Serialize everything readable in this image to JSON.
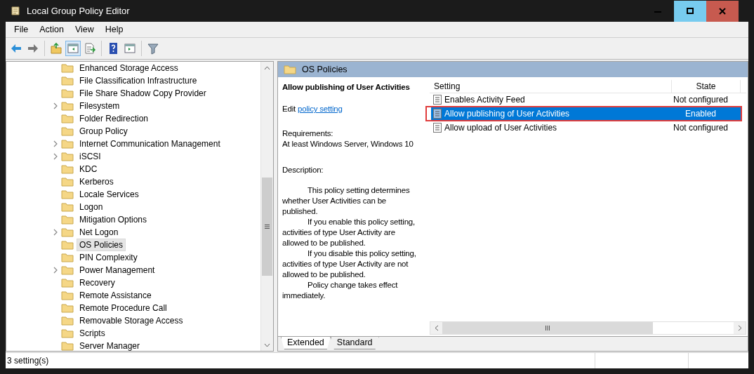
{
  "window": {
    "title": "Local Group Policy Editor"
  },
  "menu": [
    "File",
    "Action",
    "View",
    "Help"
  ],
  "toolbar": [
    {
      "kind": "back",
      "selected": false
    },
    {
      "kind": "forward",
      "selected": false
    },
    {
      "kind": "separator"
    },
    {
      "kind": "up",
      "selected": false
    },
    {
      "kind": "console-tree",
      "selected": true
    },
    {
      "kind": "export",
      "selected": false
    },
    {
      "kind": "separator"
    },
    {
      "kind": "help",
      "selected": false
    },
    {
      "kind": "show-pane",
      "selected": false
    },
    {
      "kind": "separator"
    },
    {
      "kind": "filter",
      "selected": false
    }
  ],
  "tree": {
    "items": [
      {
        "label": "Enhanced Storage Access",
        "kind": "leaf",
        "selected": false
      },
      {
        "label": "File Classification Infrastructure",
        "kind": "leaf",
        "selected": false
      },
      {
        "label": "File Share Shadow Copy Provider",
        "kind": "leaf",
        "selected": false
      },
      {
        "label": "Filesystem",
        "kind": "branch",
        "selected": false
      },
      {
        "label": "Folder Redirection",
        "kind": "leaf",
        "selected": false
      },
      {
        "label": "Group Policy",
        "kind": "leaf",
        "selected": false
      },
      {
        "label": "Internet Communication Management",
        "kind": "branch",
        "selected": false
      },
      {
        "label": "iSCSI",
        "kind": "branch",
        "selected": false
      },
      {
        "label": "KDC",
        "kind": "leaf",
        "selected": false
      },
      {
        "label": "Kerberos",
        "kind": "leaf",
        "selected": false
      },
      {
        "label": "Locale Services",
        "kind": "leaf",
        "selected": false
      },
      {
        "label": "Logon",
        "kind": "leaf",
        "selected": false
      },
      {
        "label": "Mitigation Options",
        "kind": "leaf",
        "selected": false
      },
      {
        "label": "Net Logon",
        "kind": "branch",
        "selected": false
      },
      {
        "label": "OS Policies",
        "kind": "leaf",
        "selected": true
      },
      {
        "label": "PIN Complexity",
        "kind": "leaf",
        "selected": false
      },
      {
        "label": "Power Management",
        "kind": "branch",
        "selected": false
      },
      {
        "label": "Recovery",
        "kind": "leaf",
        "selected": false
      },
      {
        "label": "Remote Assistance",
        "kind": "leaf",
        "selected": false
      },
      {
        "label": "Remote Procedure Call",
        "kind": "leaf",
        "selected": false
      },
      {
        "label": "Removable Storage Access",
        "kind": "leaf",
        "selected": false
      },
      {
        "label": "Scripts",
        "kind": "leaf",
        "selected": false
      },
      {
        "label": "Server Manager",
        "kind": "leaf",
        "selected": false
      }
    ]
  },
  "details": {
    "header": "OS Policies",
    "title": "Allow publishing of User Activities",
    "edit_prefix": "Edit",
    "edit_link": "policy setting",
    "requirements_label": "Requirements:",
    "requirements": "At least Windows Server, Windows 10",
    "description_label": "Description:",
    "paragraphs": [
      "This policy setting determines whether User Activities can be published.",
      "If you enable this policy setting, activities of type User Activity are allowed to be published.",
      "If you disable this policy setting, activities of type User Activity are not allowed to be published.",
      "Policy change takes effect immediately."
    ]
  },
  "list": {
    "columns": [
      "Setting",
      "State"
    ],
    "rows": [
      {
        "setting": "Enables Activity Feed",
        "state": "Not configured",
        "selected": false,
        "highlighted": false
      },
      {
        "setting": "Allow publishing of User Activities",
        "state": "Enabled",
        "selected": true,
        "highlighted": true
      },
      {
        "setting": "Allow upload of User Activities",
        "state": "Not configured",
        "selected": false,
        "highlighted": false
      }
    ]
  },
  "tabs": [
    {
      "label": "Extended",
      "selected": true
    },
    {
      "label": "Standard",
      "selected": false
    }
  ],
  "status_bar": {
    "text": "3 setting(s)"
  }
}
